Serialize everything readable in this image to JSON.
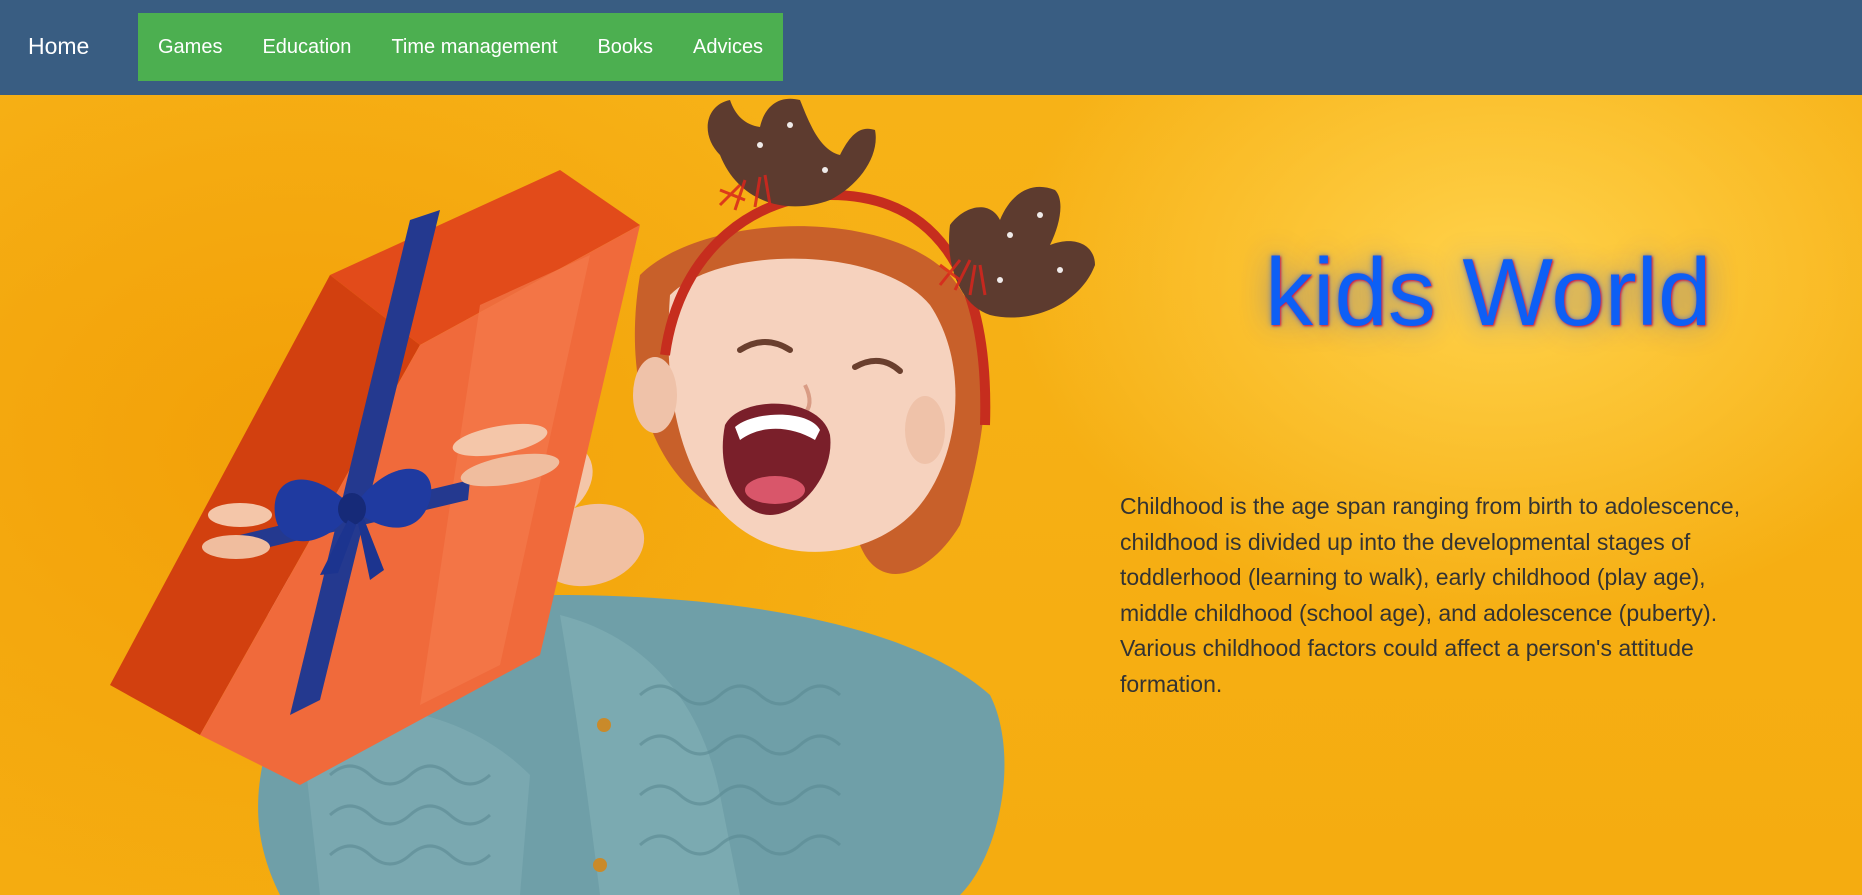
{
  "nav": {
    "home_label": "Home",
    "items": [
      {
        "label": "Games"
      },
      {
        "label": "Education"
      },
      {
        "label": "Time management"
      },
      {
        "label": "Books"
      },
      {
        "label": "Advices"
      }
    ]
  },
  "hero": {
    "title": "kids World",
    "description": "Childhood is the age span ranging from birth to adolescence, childhood is divided up into the developmental stages of toddlerhood (learning to walk), early childhood (play age), middle childhood (school age), and adolescence (puberty). Various childhood factors could affect a person's attitude formation."
  },
  "colors": {
    "navbar_bg": "#395d82",
    "nav_group_bg": "#4caf50",
    "hero_bg": "#f7b217",
    "title_color": "#0d5ff5",
    "text_color": "#333333"
  }
}
